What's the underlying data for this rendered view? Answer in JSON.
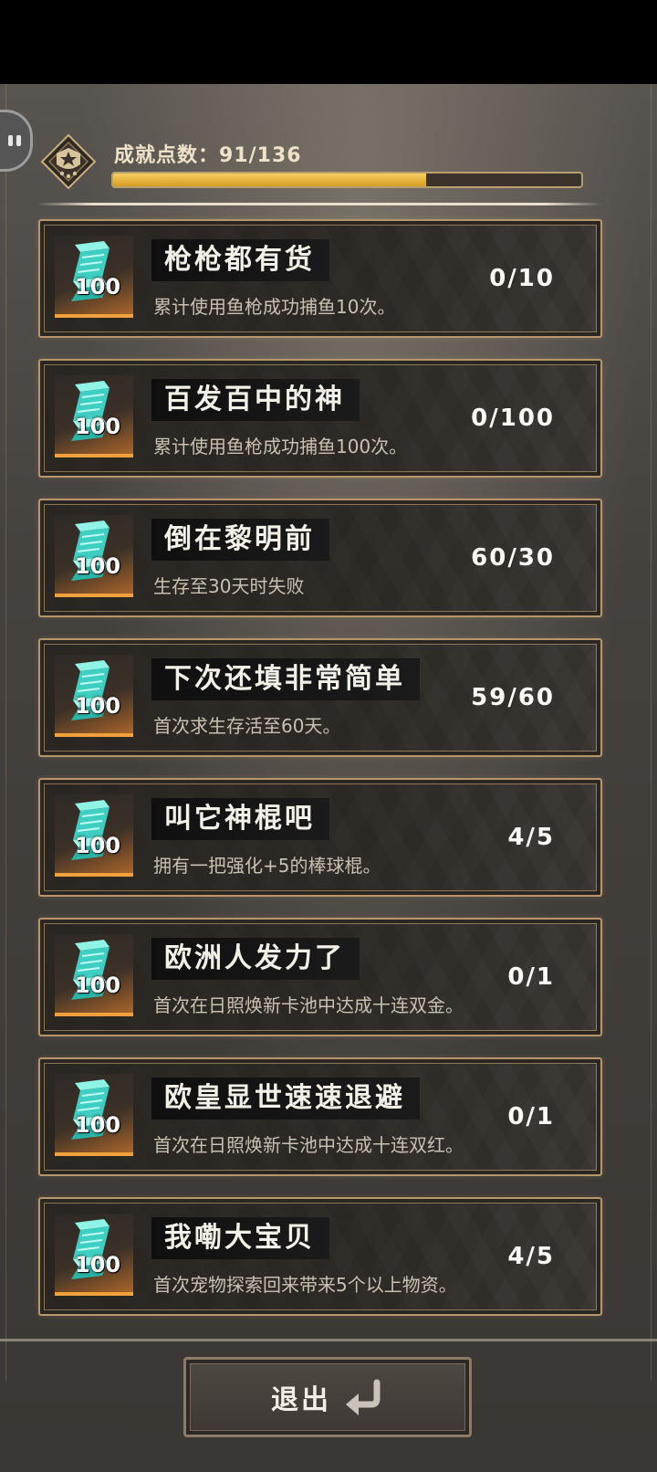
{
  "header": {
    "points_label": "成就点数：91/136",
    "points_current": 91,
    "points_total": 136
  },
  "achievements": [
    {
      "title": "枪枪都有货",
      "description": "累计使用鱼枪成功捕鱼10次。",
      "progress": "0/10",
      "reward": "100"
    },
    {
      "title": "百发百中的神",
      "description": "累计使用鱼枪成功捕鱼100次。",
      "progress": "0/100",
      "reward": "100"
    },
    {
      "title": "倒在黎明前",
      "description": "生存至30天时失败",
      "progress": "60/30",
      "reward": "100"
    },
    {
      "title": "下次还填非常简单",
      "description": "首次求生存活至60天。",
      "progress": "59/60",
      "reward": "100"
    },
    {
      "title": "叫它神棍吧",
      "description": "拥有一把强化+5的棒球棍。",
      "progress": "4/5",
      "reward": "100"
    },
    {
      "title": "欧洲人发力了",
      "description": "首次在日照焕新卡池中达成十连双金。",
      "progress": "0/1",
      "reward": "100"
    },
    {
      "title": "欧皇显世速速退避",
      "description": "首次在日照焕新卡池中达成十连双红。",
      "progress": "0/1",
      "reward": "100"
    },
    {
      "title": "我嘞大宝贝",
      "description": "首次宠物探索回来带来5个以上物资。",
      "progress": "4/5",
      "reward": "100"
    }
  ],
  "footer": {
    "exit_label": "退出"
  },
  "icons": {
    "reward_icon": "ticket-icon",
    "badge_icon": "star-badge-icon",
    "exit_icon": "return-arrow-icon",
    "side_tab_icon": "pause-icon"
  },
  "colors": {
    "progress_fill": "#e0a936",
    "card_border": "#b6966a",
    "reward_underline": "#f0a13c"
  }
}
